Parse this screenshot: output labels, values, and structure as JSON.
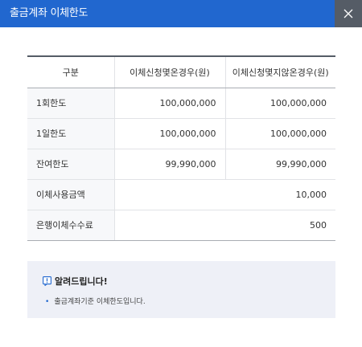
{
  "dialog": {
    "title": "출금계좌 이체한도",
    "close_icon": "close-icon"
  },
  "table": {
    "headers": [
      "구분",
      "이체신청몇온경우(원)",
      "이체신청몇지않온경우(원)"
    ],
    "rows": [
      {
        "label": "1회한도",
        "signed": "100,000,000",
        "unsigned": "100,000,000"
      },
      {
        "label": "1일한도",
        "signed": "100,000,000",
        "unsigned": "100,000,000"
      },
      {
        "label": "잔여한도",
        "signed": "99,990,000",
        "unsigned": "99,990,000"
      },
      {
        "label": "이체사용금액",
        "value": "10,000"
      },
      {
        "label": "은행이체수수료",
        "value": "500"
      }
    ]
  },
  "notice": {
    "icon": "alert-icon",
    "title": "알려드립니다!",
    "items": [
      "출금계좌기준 이체한도입니다."
    ]
  },
  "colors": {
    "header_bg": "#2167cf",
    "close_bg": "#555c66",
    "notice_bg": "#eef0f7"
  }
}
